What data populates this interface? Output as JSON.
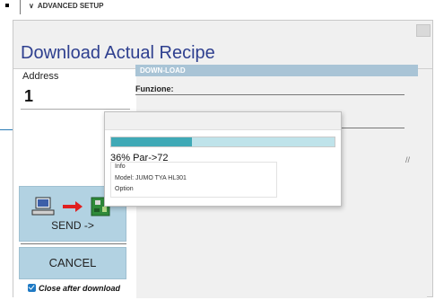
{
  "background": {
    "section_label": "ADVANCED SETUP"
  },
  "dialog": {
    "title": "Download Actual Recipe",
    "address": {
      "label": "Address",
      "value": "1"
    },
    "send_label": "SEND ->",
    "cancel_label": "CANCEL",
    "close_after_label": "Close after download",
    "close_after_checked": true,
    "download_section": "DOWN-LOAD",
    "funzione_label": "Funzione:"
  },
  "progress": {
    "percent": 36,
    "status_text": "36% Par->72",
    "info_legend": "Info",
    "model_text": "Model: JUMO TYA HL301",
    "option_text": "Option"
  },
  "colors": {
    "title": "#2e3f8f",
    "button_bg": "#b2d2e2",
    "progress_fill": "#3fa9b6",
    "progress_track": "#bfe3ea",
    "section_bar": "#a9c4d6",
    "checkbox": "#1f7ac4"
  },
  "icons": [
    "computer-icon",
    "arrow-right-icon",
    "device-board-icon",
    "chevron-down-icon",
    "close-icon",
    "checkbox-icon"
  ]
}
